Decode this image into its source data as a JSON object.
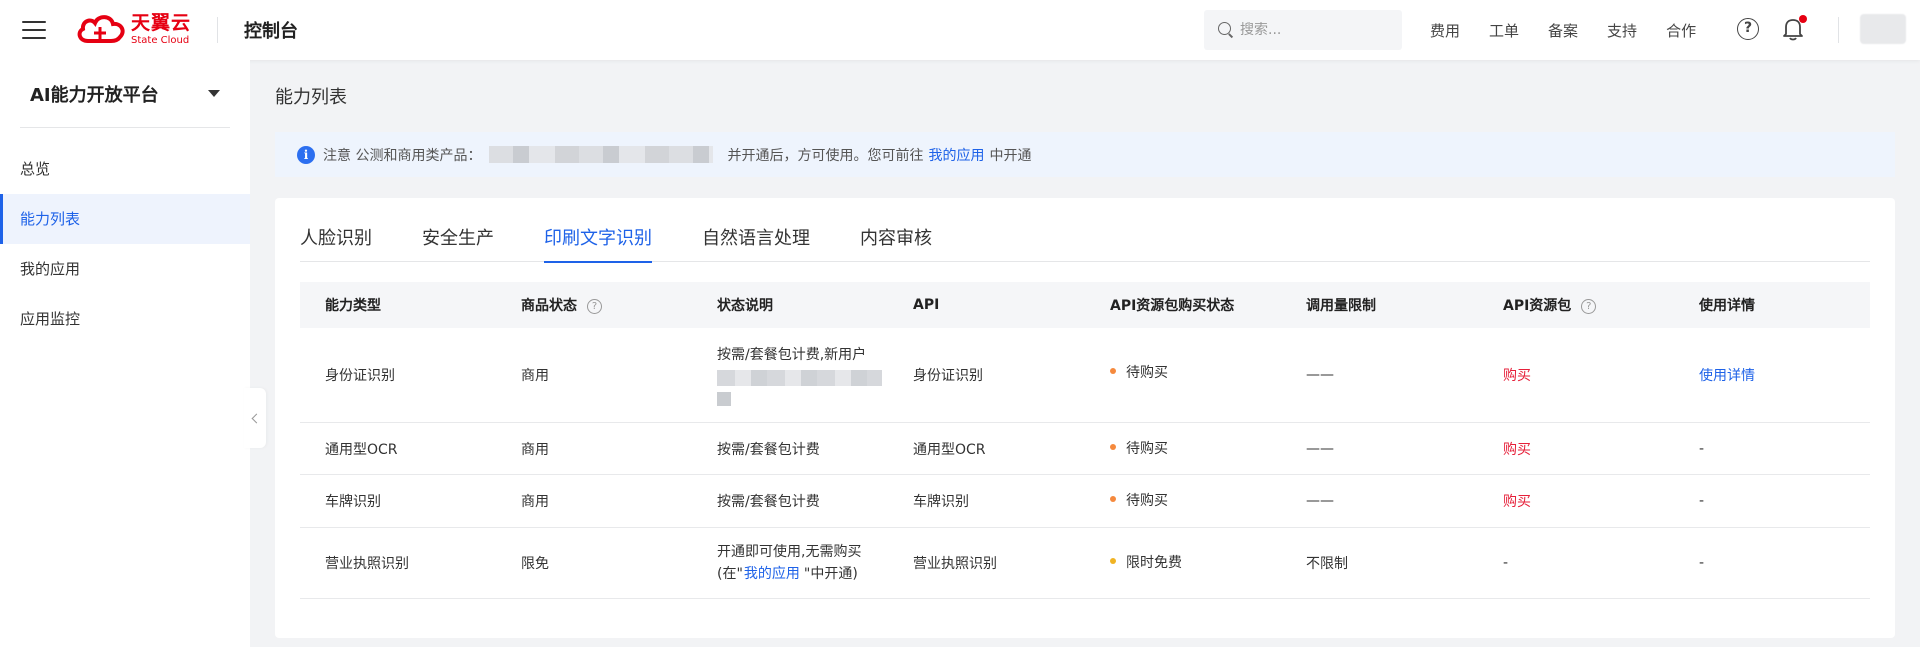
{
  "topbar": {
    "logo_cn": "天翼云",
    "logo_en": "State Cloud",
    "console": "控制台",
    "search_placeholder": "搜索...",
    "nav": [
      "费用",
      "工单",
      "备案",
      "支持",
      "合作"
    ],
    "help": "?"
  },
  "sidebar": {
    "platform": "AI能力开放平台",
    "items": [
      {
        "label": "总览",
        "active": false
      },
      {
        "label": "能力列表",
        "active": true
      },
      {
        "label": "我的应用",
        "active": false
      },
      {
        "label": "应用监控",
        "active": false
      }
    ]
  },
  "main": {
    "page_title": "能力列表",
    "notice": {
      "prefix": "注意 公测和商用类产品：",
      "middle": "并开通后，方可使用。您可前往",
      "link": "我的应用",
      "suffix": "中开通"
    },
    "tabs": [
      "人脸识别",
      "安全生产",
      "印刷文字识别",
      "自然语言处理",
      "内容审核"
    ],
    "active_tab": 2,
    "table": {
      "headers": [
        "能力类型",
        "商品状态",
        "状态说明",
        "API",
        "API资源包购买状态",
        "调用量限制",
        "API资源包",
        "使用详情"
      ],
      "rows": [
        {
          "type": "身份证识别",
          "status": "商用",
          "desc": "按需/套餐包计费,新用户",
          "api": "身份证识别",
          "buy_status": "待购买",
          "limit": "——",
          "pack": "购买",
          "detail": "使用详情"
        },
        {
          "type": "通用型OCR",
          "status": "商用",
          "desc": "按需/套餐包计费",
          "api": "通用型OCR",
          "buy_status": "待购买",
          "limit": "——",
          "pack": "购买",
          "detail": "-"
        },
        {
          "type": "车牌识别",
          "status": "商用",
          "desc": "按需/套餐包计费",
          "api": "车牌识别",
          "buy_status": "待购买",
          "limit": "——",
          "pack": "购买",
          "detail": "-"
        },
        {
          "type": "营业执照识别",
          "status": "限免",
          "desc_line1": "开通即可使用,无需购买",
          "desc_line2_prefix": "(在\"",
          "desc_link": "我的应用",
          "desc_line2_suffix": "\"中开通)",
          "api": "营业执照识别",
          "buy_status": "限时免费",
          "limit": "不限制",
          "pack": "-",
          "detail": "-"
        }
      ]
    }
  },
  "colors": {
    "accent": "#1e62e8",
    "brand_red": "#e60012",
    "buy_red": "#e6203a",
    "dot_pending": "#f5893d",
    "dot_free": "#f0b323"
  }
}
